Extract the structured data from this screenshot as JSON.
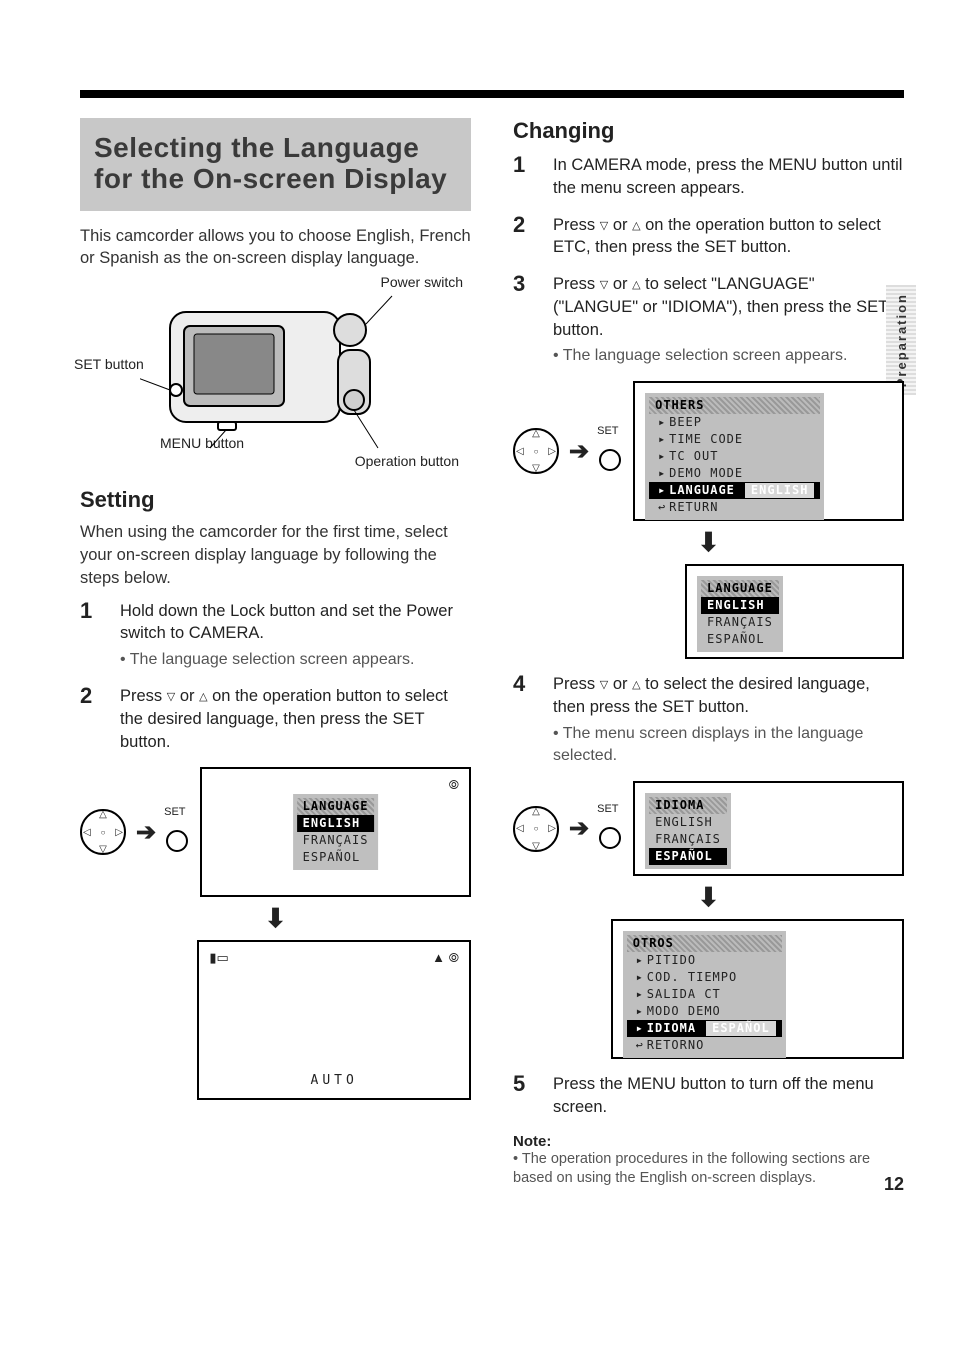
{
  "page_number": "12",
  "side_tab": "Preparation",
  "heading": "Selecting the Language for the On-screen Display",
  "intro": "This camcorder allows you to choose English, French or Spanish as the on-screen display language.",
  "cam_labels": {
    "power_switch": "Power switch",
    "set_button": "SET button",
    "menu_button": "MENU button",
    "operation_button": "Operation button"
  },
  "setting": {
    "title": "Setting",
    "intro": "When using the camcorder for the first time, select your on-screen display language by following the steps below.",
    "steps": [
      {
        "num": "1",
        "text": "Hold down the Lock button and set the Power switch to CAMERA.",
        "sub": [
          "The language selection screen appears."
        ]
      },
      {
        "num": "2",
        "text_parts": [
          "Press ",
          " or ",
          " on the operation button to select the desired language, then press the SET button."
        ]
      }
    ],
    "screen1": {
      "header": "LANGUAGE",
      "items": [
        "ENGLISH",
        "FRANÇAIS",
        "ESPAÑOL"
      ],
      "selected": "ENGLISH"
    },
    "screen2": {
      "auto": "AUTO"
    },
    "set_label": "SET"
  },
  "changing": {
    "title": "Changing",
    "steps": [
      {
        "num": "1",
        "text": "In CAMERA mode, press the MENU button until the menu screen appears."
      },
      {
        "num": "2",
        "text_parts": [
          "Press ",
          " or ",
          " on the operation button to select ETC, then press the SET button."
        ]
      },
      {
        "num": "3",
        "text_parts": [
          "Press ",
          " or ",
          " to select \"LANGUAGE\" (\"LANGUE\" or \"IDIOMA\"), then press the SET button."
        ],
        "sub": [
          "The language selection screen appears."
        ]
      },
      {
        "num": "4",
        "text_parts": [
          "Press ",
          " or ",
          " to select the desired language, then press the SET button."
        ],
        "sub": [
          "The menu screen displays in the language selected."
        ]
      },
      {
        "num": "5",
        "text": "Press the MENU button to turn off the menu screen."
      }
    ],
    "menu_en": {
      "header": "OTHERS",
      "items": [
        "BEEP",
        "TIME CODE",
        "TC OUT",
        "DEMO MODE",
        "LANGUAGE",
        "RETURN"
      ],
      "selected": "LANGUAGE",
      "value": "ENGLISH"
    },
    "lang_sel_en": {
      "header": "LANGUAGE",
      "items": [
        "ENGLISH",
        "FRANÇAIS",
        "ESPAÑOL"
      ],
      "selected": "ENGLISH"
    },
    "lang_sel_es": {
      "header": "IDIOMA",
      "items": [
        "ENGLISH",
        "FRANÇAIS",
        "ESPAÑOL"
      ],
      "selected": "ESPAÑOL"
    },
    "menu_es": {
      "header": "OTROS",
      "items": [
        "PITIDO",
        "COD. TIEMPO",
        "SALIDA CT",
        "MODO DEMO",
        "IDIOMA",
        "RETORNO"
      ],
      "selected": "IDIOMA",
      "value": "ESPAÑOL"
    },
    "set_label": "SET",
    "note_head": "Note:",
    "note_body": "The operation procedures in the following sections are based on using the English on-screen displays."
  }
}
